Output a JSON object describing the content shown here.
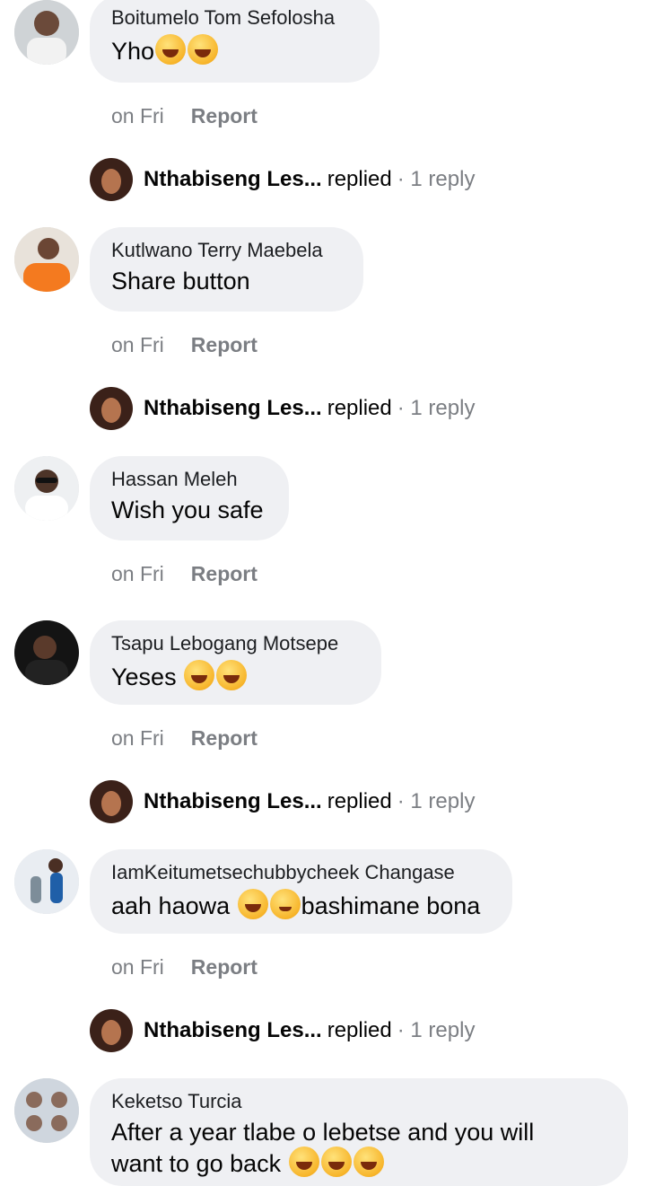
{
  "comments": [
    {
      "author": "Boitumelo Tom Sefolosha",
      "text": "Yho",
      "emojis": [
        "laugh-cry",
        "rofl"
      ],
      "time": "on Fri",
      "report": "Report",
      "reply": {
        "name": "Nthabiseng Les...",
        "verb": "replied",
        "count": "· 1 reply"
      }
    },
    {
      "author": "Kutlwano Terry Maebela",
      "text": "Share button",
      "emojis": [],
      "time": "on Fri",
      "report": "Report",
      "reply": {
        "name": "Nthabiseng Les...",
        "verb": "replied",
        "count": "· 1 reply"
      }
    },
    {
      "author": "Hassan Meleh",
      "text": "Wish you safe",
      "emojis": [],
      "time": "on Fri",
      "report": "Report"
    },
    {
      "author": "Tsapu Lebogang Motsepe",
      "text": "Yeses ",
      "emojis": [
        "rofl",
        "rofl"
      ],
      "time": "on Fri",
      "report": "Report",
      "reply": {
        "name": "Nthabiseng Les...",
        "verb": "replied",
        "count": "· 1 reply"
      }
    },
    {
      "author": "IamKeitumetsechubbycheek Changase",
      "text_before": "aah haowa ",
      "text_after": "bashimane bona",
      "emojis": [
        "laugh-cry",
        "wink"
      ],
      "time": "on Fri",
      "report": "Report",
      "reply": {
        "name": "Nthabiseng Les...",
        "verb": "replied",
        "count": "· 1 reply"
      }
    },
    {
      "author": "Keketso Turcia",
      "text": "After a year tlabe o lebetse and you will want to go back ",
      "emojis": [
        "laugh-cry",
        "laugh-cry",
        "laugh-cry"
      ]
    }
  ]
}
